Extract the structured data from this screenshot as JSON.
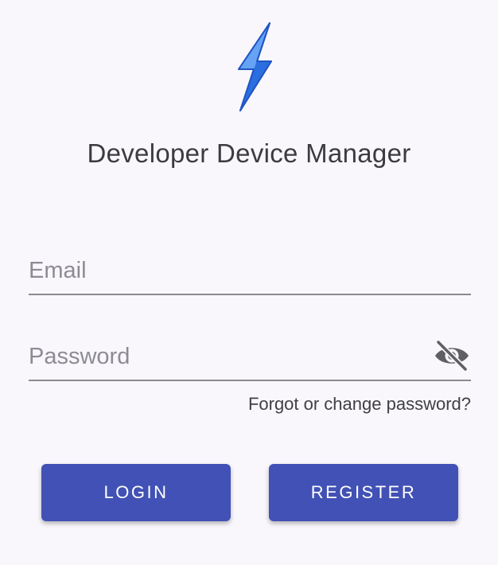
{
  "app": {
    "title": "Developer Device Manager",
    "logo_icon": "lightning-bolt-icon",
    "accent_color": "#4151b5",
    "logo_color": "#3f86f0"
  },
  "form": {
    "email": {
      "placeholder": "Email",
      "value": ""
    },
    "password": {
      "placeholder": "Password",
      "value": "",
      "visibility_icon": "eye-off-icon"
    },
    "forgot_link": "Forgot or change password?"
  },
  "buttons": {
    "login_label": "LOGIN",
    "register_label": "REGISTER"
  }
}
